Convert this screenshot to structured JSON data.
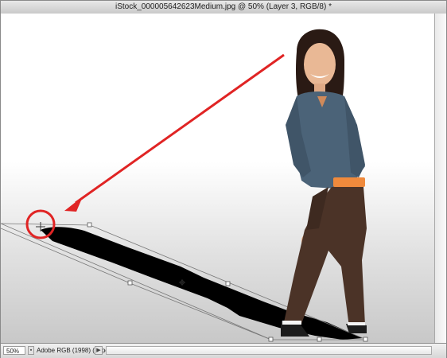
{
  "window": {
    "title": "iStock_000005642623Medium.jpg @ 50% (Layer 3, RGB/8) *"
  },
  "status": {
    "zoom": "50%",
    "doc_info": "Adobe RGB (1998) (8bpc)"
  },
  "icons": {
    "status_menu": "triangle-right-icon",
    "zoom_toggle": "small-square-icon"
  },
  "colors": {
    "annotation": "#e02424",
    "shadow": "#000000",
    "jacket": "#4b6378",
    "pants": "#4b3327",
    "shirt": "#f08a3c"
  }
}
